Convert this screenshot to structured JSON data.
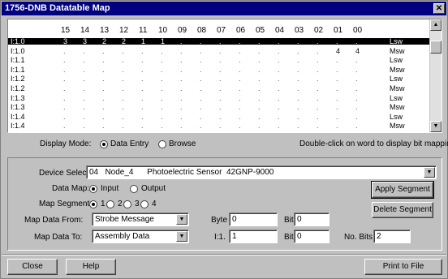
{
  "window": {
    "title": "1756-DNB Datatable Map"
  },
  "grid": {
    "bit_headers": [
      "15",
      "14",
      "13",
      "12",
      "11",
      "10",
      "09",
      "08",
      "07",
      "06",
      "05",
      "04",
      "03",
      "02",
      "01",
      "00"
    ],
    "rows": [
      {
        "addr": "I:1.0",
        "word": "Lsw",
        "vals": {
          "15": "3",
          "14": "3",
          "13": "2",
          "12": "2",
          "11": "1",
          "10": "1"
        },
        "selected": true
      },
      {
        "addr": "I:1.0",
        "word": "Msw",
        "vals": {
          "01": "4",
          "00": "4"
        },
        "selected": false
      },
      {
        "addr": "I:1.1",
        "word": "Lsw",
        "vals": {},
        "selected": false
      },
      {
        "addr": "I:1.1",
        "word": "Msw",
        "vals": {},
        "selected": false
      },
      {
        "addr": "I:1.2",
        "word": "Lsw",
        "vals": {},
        "selected": false
      },
      {
        "addr": "I:1.2",
        "word": "Msw",
        "vals": {},
        "selected": false
      },
      {
        "addr": "I:1.3",
        "word": "Lsw",
        "vals": {},
        "selected": false
      },
      {
        "addr": "I:1.3",
        "word": "Msw",
        "vals": {},
        "selected": false
      },
      {
        "addr": "I:1.4",
        "word": "Lsw",
        "vals": {},
        "selected": false
      },
      {
        "addr": "I:1.4",
        "word": "Msw",
        "vals": {},
        "selected": false
      }
    ]
  },
  "display_mode": {
    "label": "Display Mode:",
    "options": [
      "Data Entry",
      "Browse"
    ],
    "selected": "Data Entry",
    "hint": "Double-click on word to display bit mapping"
  },
  "device_select": {
    "label": "Device Select:",
    "value": "04   Node_4      Photoelectric Sensor  42GNP-9000"
  },
  "data_map": {
    "label": "Data Map:",
    "options": [
      "Input",
      "Output"
    ],
    "selected": "Input"
  },
  "map_segment": {
    "label": "Map Segment:",
    "options": [
      "1",
      "2",
      "3",
      "4"
    ],
    "selected": "1"
  },
  "map_from": {
    "label": "Map Data From:",
    "value": "Strobe Message"
  },
  "map_to": {
    "label": "Map Data To:",
    "value": "Assembly Data"
  },
  "byte": {
    "label": "Byte",
    "value": "0"
  },
  "bit1": {
    "label": "Bit",
    "value": "0"
  },
  "i1": {
    "label": "I:1.",
    "value": "1"
  },
  "bit2": {
    "label": "Bit",
    "value": "0"
  },
  "nbits": {
    "label": "No. Bits",
    "value": "2"
  },
  "buttons": {
    "apply": "Apply Segment",
    "delete": "Delete Segment",
    "close": "Close",
    "help": "Help",
    "print": "Print to File"
  }
}
